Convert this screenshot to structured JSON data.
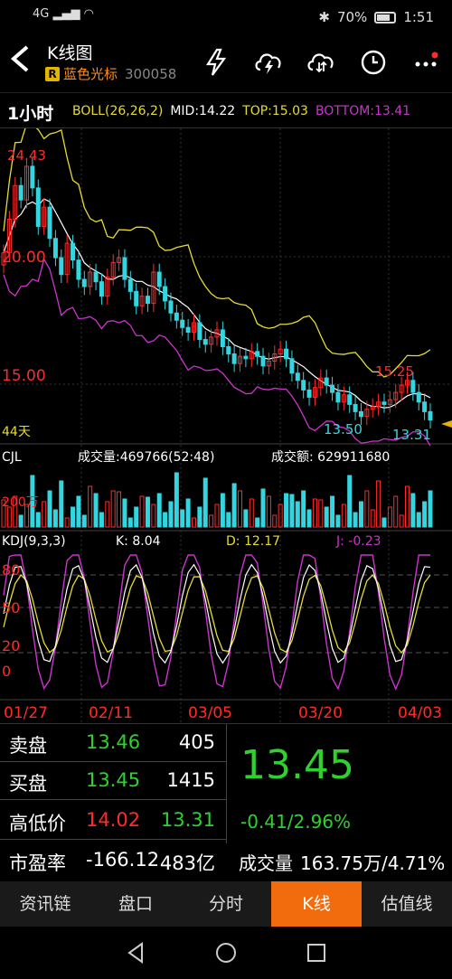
{
  "status": {
    "signal": "4G",
    "battery": "70%",
    "time": "1:51"
  },
  "header": {
    "title": "K线图",
    "badge": "R",
    "stock_name": "蓝色光标",
    "stock_code": "300058"
  },
  "infobar": {
    "period": "1小时",
    "boll": "BOLL(26,26,2)",
    "mid": "MID:14.22",
    "top": "TOP:15.03",
    "bottom": "BOTTOM:13.41"
  },
  "colors": {
    "up": "#ff2b2b",
    "down": "#33d6e0",
    "mid": "#ffffff",
    "top": "#e6dc33",
    "bottom": "#cc33cc",
    "accent": "#f26c0d",
    "green": "#2ed12e"
  },
  "chart_data": {
    "type": "candlestick",
    "price_labels": {
      "high": "24.43",
      "y20": "20.00",
      "y15": "15.00",
      "low_mark": "13.50",
      "peak_mark": "15.25",
      "last_low": "13.31"
    },
    "days_label": "44天",
    "ylim": [
      12.8,
      25.2
    ],
    "closes": [
      20.4,
      21.8,
      23.2,
      22.6,
      24.0,
      23.1,
      21.5,
      22.3,
      21.0,
      20.2,
      19.5,
      20.8,
      20.1,
      19.3,
      19.0,
      19.6,
      19.2,
      18.6,
      19.4,
      20.0,
      20.2,
      19.3,
      18.8,
      18.2,
      18.6,
      18.3,
      19.6,
      19.0,
      18.4,
      17.9,
      17.6,
      17.3,
      17.1,
      17.5,
      16.8,
      16.6,
      16.9,
      17.2,
      16.5,
      16.2,
      15.8,
      16.1,
      16.0,
      16.3,
      16.1,
      15.7,
      15.9,
      16.2,
      16.4,
      16.0,
      15.4,
      15.1,
      14.7,
      14.4,
      14.8,
      15.2,
      14.9,
      14.6,
      14.2,
      14.5,
      14.1,
      13.8,
      13.6,
      13.9,
      14.0,
      14.2,
      14.1,
      14.3,
      14.6,
      14.9,
      15.1,
      14.6,
      14.2,
      13.8,
      13.45
    ],
    "cjl": {
      "label": "CJL",
      "volume": "成交量:469766(52:48)",
      "amount": "成交额: 629911680",
      "marker": "200万"
    },
    "kdj": {
      "label": "KDJ(9,3,3)",
      "k": "K: 8.04",
      "d": "D: 12.17",
      "j": "J: -0.23",
      "levels": [
        "80",
        "50",
        "20",
        "0"
      ]
    },
    "dates": [
      "01/27",
      "02/11",
      "03/05",
      "03/20",
      "04/03"
    ]
  },
  "quote": {
    "sell_label": "卖盘",
    "sell_price": "13.46",
    "sell_vol": "405",
    "buy_label": "买盘",
    "buy_price": "13.45",
    "buy_vol": "1415",
    "hl_label": "高低价",
    "high": "14.02",
    "low": "13.31",
    "pe_label": "市盈率",
    "pe": "-166.12",
    "mktcap": "483亿",
    "price": "13.45",
    "change": "-0.41/2.96%",
    "vol_label": "成交量",
    "vol_value": "163.75万/4.71%"
  },
  "tabs": [
    "资讯链",
    "盘口",
    "分时",
    "K线",
    "估值线"
  ],
  "active_tab": 3
}
